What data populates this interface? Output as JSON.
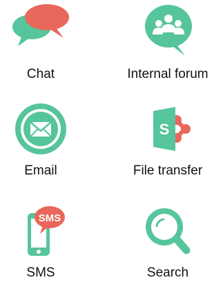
{
  "colors": {
    "accent_green": "#56c59b",
    "accent_red": "#e8675a",
    "bg": "#ffffff",
    "text": "#111111"
  },
  "items": [
    {
      "label": "Chat",
      "icon": "chat-bubbles-icon"
    },
    {
      "label": "Internal forum",
      "icon": "forum-group-icon"
    },
    {
      "label": "Email",
      "icon": "envelope-icon"
    },
    {
      "label": "File transfer",
      "icon": "sharepoint-icon"
    },
    {
      "label": "SMS",
      "icon": "phone-sms-icon",
      "badge": "SMS"
    },
    {
      "label": "Search",
      "icon": "magnifier-icon"
    }
  ]
}
